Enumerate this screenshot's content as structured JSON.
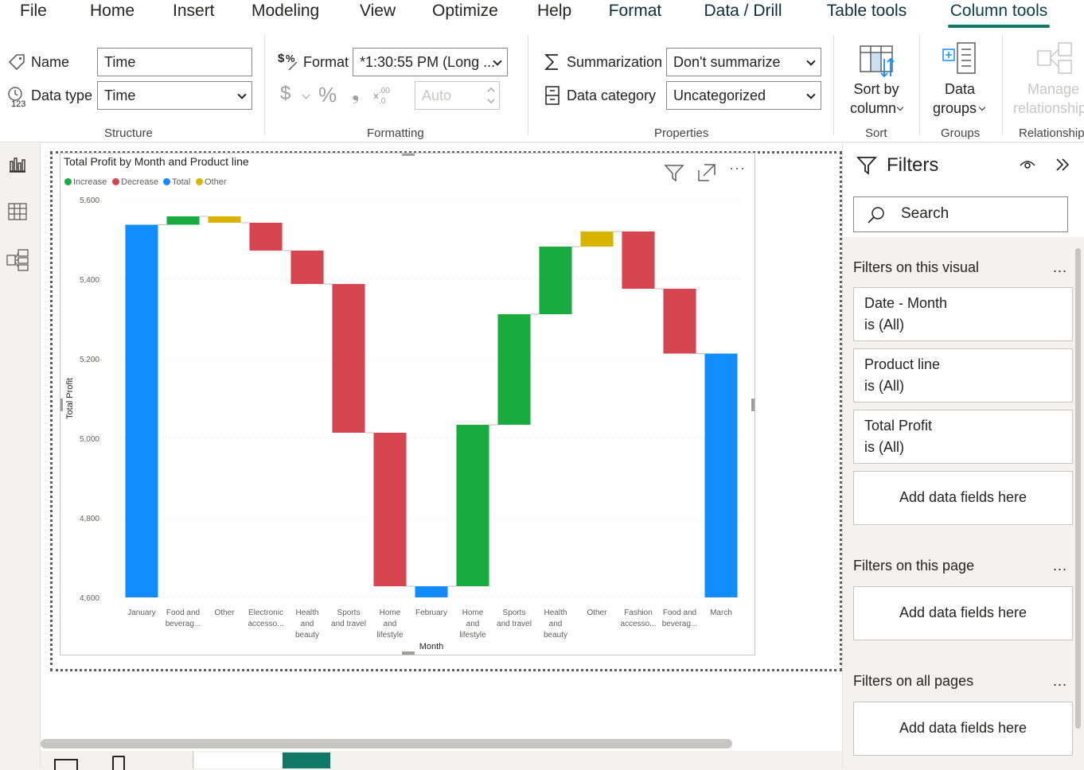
{
  "tabs": [
    {
      "label": "File",
      "contextual": false
    },
    {
      "label": "Home",
      "contextual": false
    },
    {
      "label": "Insert",
      "contextual": false
    },
    {
      "label": "Modeling",
      "contextual": false
    },
    {
      "label": "View",
      "contextual": false
    },
    {
      "label": "Optimize",
      "contextual": false
    },
    {
      "label": "Help",
      "contextual": false
    },
    {
      "label": "Format",
      "contextual": true
    },
    {
      "label": "Data / Drill",
      "contextual": true
    },
    {
      "label": "Table tools",
      "contextual": true
    },
    {
      "label": "Column tools",
      "contextual": true,
      "active": true
    }
  ],
  "ribbon": {
    "structure": {
      "name_label": "Name",
      "name_value": "Time",
      "datatype_label": "Data type",
      "datatype_value": "Time",
      "group_label": "Structure"
    },
    "formatting": {
      "format_label": "Format",
      "format_value": "*1:30:55 PM (Long ...",
      "currency_symbol": "$",
      "percent_symbol": "%",
      "comma_symbol": "❟",
      "decimals_value": "Auto",
      "group_label": "Formatting"
    },
    "properties": {
      "summarization_label": "Summarization",
      "summarization_value": "Don't summarize",
      "category_label": "Data category",
      "category_value": "Uncategorized",
      "group_label": "Properties"
    },
    "sort": {
      "button_line1": "Sort by",
      "button_line2": "column",
      "group_label": "Sort"
    },
    "groups": {
      "button_line1": "Data",
      "button_line2": "groups",
      "group_label": "Groups"
    },
    "relationships": {
      "button_line1": "Manage",
      "button_line2": "relationships",
      "group_label": "Relationships"
    }
  },
  "visual": {
    "title": "Total Profit by Month and Product line"
  },
  "chart_data": {
    "type": "waterfall",
    "title": "Total Profit by Month and Product line",
    "xlabel": "Month",
    "ylabel": "Total Profit",
    "ylim": [
      4600,
      5600
    ],
    "yticks": [
      "5,600",
      "5,400",
      "5,200",
      "5,000",
      "4,800",
      "4,600"
    ],
    "yticks_values": [
      5600,
      5400,
      5200,
      5000,
      4800,
      4600
    ],
    "legend": [
      {
        "name": "Increase",
        "color": "#1aab40"
      },
      {
        "name": "Decrease",
        "color": "#d64550"
      },
      {
        "name": "Total",
        "color": "#118dff"
      },
      {
        "name": "Other",
        "color": "#d9b300"
      }
    ],
    "legend_position": "top-left",
    "grid": true,
    "bars": [
      {
        "label": [
          "January"
        ],
        "kind": "Total",
        "start": 4600,
        "end": 5537
      },
      {
        "label": [
          "Food and",
          "beverag..."
        ],
        "kind": "Increase",
        "start": 5537,
        "end": 5558
      },
      {
        "label": [
          "Other"
        ],
        "kind": "Other",
        "start": 5558,
        "end": 5542
      },
      {
        "label": [
          "Electronic",
          "accesso..."
        ],
        "kind": "Decrease",
        "start": 5542,
        "end": 5472
      },
      {
        "label": [
          "Health",
          "and",
          "beauty"
        ],
        "kind": "Decrease",
        "start": 5472,
        "end": 5388
      },
      {
        "label": [
          "Sports",
          "and travel"
        ],
        "kind": "Decrease",
        "start": 5388,
        "end": 5014
      },
      {
        "label": [
          "Home",
          "and",
          "lifestyle"
        ],
        "kind": "Decrease",
        "start": 5014,
        "end": 4628
      },
      {
        "label": [
          "February"
        ],
        "kind": "Total",
        "start": 4600,
        "end": 4628
      },
      {
        "label": [
          "Home",
          "and",
          "lifestyle"
        ],
        "kind": "Increase",
        "start": 4628,
        "end": 5034
      },
      {
        "label": [
          "Sports",
          "and travel"
        ],
        "kind": "Increase",
        "start": 5034,
        "end": 5312
      },
      {
        "label": [
          "Health",
          "and",
          "beauty"
        ],
        "kind": "Increase",
        "start": 5312,
        "end": 5482
      },
      {
        "label": [
          "Other"
        ],
        "kind": "Other",
        "start": 5482,
        "end": 5520
      },
      {
        "label": [
          "Fashion",
          "accesso..."
        ],
        "kind": "Decrease",
        "start": 5520,
        "end": 5376
      },
      {
        "label": [
          "Food and",
          "beverag..."
        ],
        "kind": "Decrease",
        "start": 5376,
        "end": 5213
      },
      {
        "label": [
          "March"
        ],
        "kind": "Total",
        "start": 4600,
        "end": 5213
      }
    ]
  },
  "filters": {
    "title": "Filters",
    "search_placeholder": "Search",
    "on_visual_label": "Filters on this visual",
    "on_page_label": "Filters on this page",
    "on_all_label": "Filters on all pages",
    "more": "...",
    "cards": [
      {
        "field": "Date - Month",
        "state": "is (All)"
      },
      {
        "field": "Product line",
        "state": "is (All)"
      },
      {
        "field": "Total Profit",
        "state": "is (All)"
      }
    ],
    "add_fields": "Add data fields here"
  }
}
